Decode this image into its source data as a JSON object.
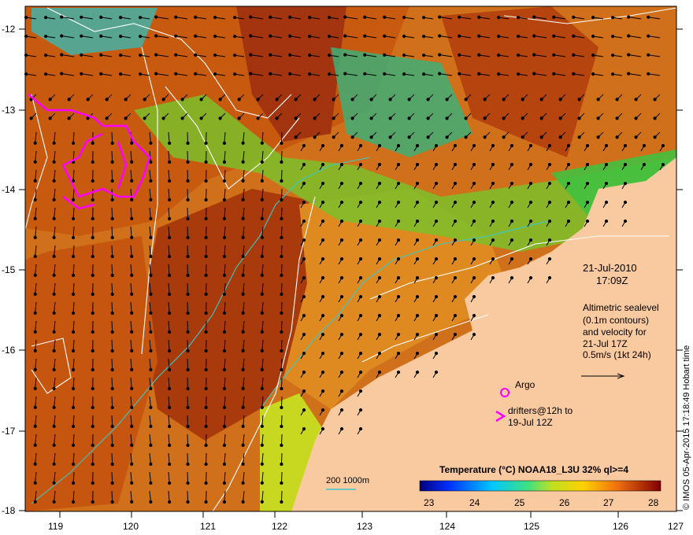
{
  "map": {
    "date": "21-Jul-2010",
    "time": "17:09Z",
    "altimetry_lines": [
      "Altimetric sealevel",
      "(0.1m contours)",
      "and velocity for",
      "21-Jul 17Z",
      "0.5m/s (1kt 24h)"
    ],
    "argo_label": "Argo",
    "drifters_lines": [
      "drifters@12h to",
      "19-Jul 12Z"
    ],
    "depth_legend": "200  1000m",
    "credit": "© IMOS 05-Apr-2015 17:18:49 Hobart time",
    "lat_labels": [
      "-12",
      "-13",
      "-14",
      "-15",
      "-16",
      "-17",
      "-18"
    ],
    "lon_labels": [
      "119",
      "120",
      "121",
      "122",
      "123",
      "124",
      "125",
      "126",
      "127"
    ],
    "colorbar": {
      "title": "Temperature (°C) NOAA18_L3U 32% ql>=4",
      "ticks": [
        "23",
        "24",
        "25",
        "26",
        "27",
        "28"
      ]
    },
    "colors": {
      "land": "#F9C9A0",
      "warm": "#C8520E",
      "hot": "#A52A0A",
      "mid": "#E08A22",
      "cool": "#5FBF3A",
      "cold": "#2B6FD0",
      "drifter": "#FF00FF",
      "bathy": "#3CC8C8",
      "contour": "#FFFFFF"
    }
  }
}
